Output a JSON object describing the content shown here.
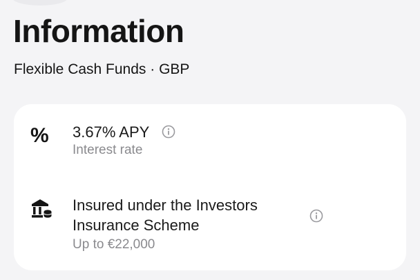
{
  "header": {
    "title": "Information",
    "subtitle": "Flexible Cash Funds · GBP"
  },
  "card": {
    "interest": {
      "icon_glyph": "%",
      "icon": "percent-icon",
      "rate": "3.67% APY",
      "label": "Interest rate",
      "info_icon": "info-circle-icon"
    },
    "insurance": {
      "icon": "bank-shield-icon",
      "title_line1": "Insured under the Investors",
      "title_line2": "Insurance Scheme",
      "label": "Up to €22,000",
      "info_icon": "info-circle-icon"
    }
  },
  "colors": {
    "background": "#f4f4f6",
    "card": "#ffffff",
    "text_primary": "#151515",
    "text_secondary": "#8a8a8e",
    "icon_muted": "#9a9a9e"
  }
}
